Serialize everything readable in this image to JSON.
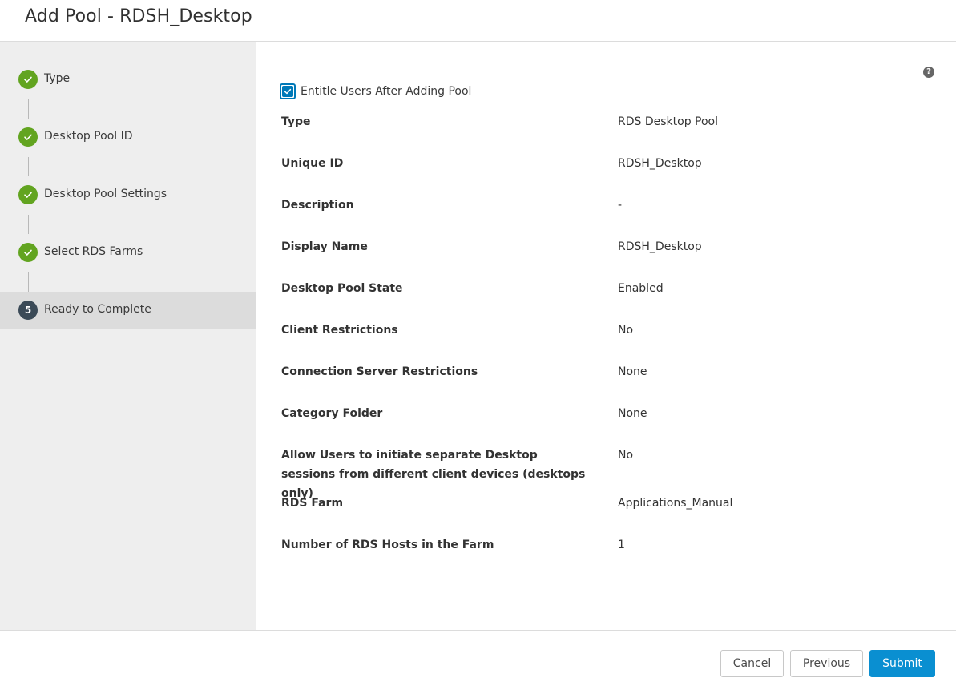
{
  "dialog": {
    "title": "Add Pool - RDSH_Desktop"
  },
  "sidebar": {
    "steps": [
      {
        "label": "Type",
        "status": "complete",
        "icon": "check-icon"
      },
      {
        "label": "Desktop Pool ID",
        "status": "complete",
        "icon": "check-icon"
      },
      {
        "label": "Desktop Pool Settings",
        "status": "complete",
        "icon": "check-icon"
      },
      {
        "label": "Select RDS Farms",
        "status": "complete",
        "icon": "check-icon"
      },
      {
        "label": "Ready to Complete",
        "status": "current",
        "number": "5"
      }
    ]
  },
  "content": {
    "help_icon": "?",
    "entitle": {
      "label": "Entitle Users After Adding Pool",
      "checked": true
    },
    "summary": [
      {
        "label": "Type",
        "value": "RDS Desktop Pool"
      },
      {
        "label": "Unique ID",
        "value": "RDSH_Desktop"
      },
      {
        "label": "Description",
        "value": "-"
      },
      {
        "label": "Display Name",
        "value": "RDSH_Desktop"
      },
      {
        "label": "Desktop Pool State",
        "value": "Enabled"
      },
      {
        "label": "Client Restrictions",
        "value": "No"
      },
      {
        "label": "Connection Server Restrictions",
        "value": "None"
      },
      {
        "label": "Category Folder",
        "value": "None"
      },
      {
        "label": "Allow Users to initiate separate Desktop sessions from different client devices (desktops only)",
        "value": "No"
      },
      {
        "label": "RDS Farm",
        "value": "Applications_Manual"
      },
      {
        "label": "Number of RDS Hosts in the Farm",
        "value": "1"
      }
    ]
  },
  "footer": {
    "cancel_label": "Cancel",
    "previous_label": "Previous",
    "submit_label": "Submit"
  },
  "colors": {
    "complete": "#62a420",
    "current": "#3b4a57",
    "primary": "#0a8fd1",
    "checkbox": "#0079b8"
  }
}
